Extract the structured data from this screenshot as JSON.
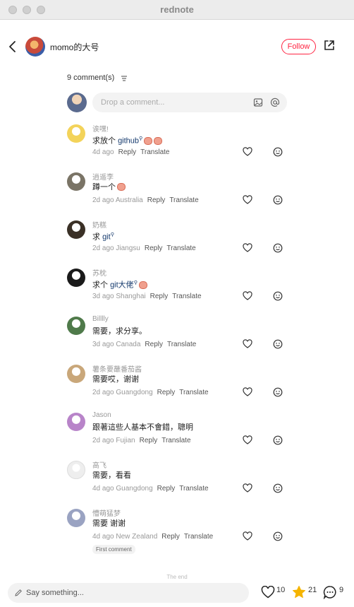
{
  "window": {
    "title": "rednote"
  },
  "header": {
    "author_name": "momo的大号",
    "follow_label": "Follow"
  },
  "comments_section": {
    "count_label": "9 comment(s)",
    "input_placeholder": "Drop a comment..."
  },
  "comments": [
    {
      "user": "诶嘿!",
      "text_before": "求放个 ",
      "link": "github",
      "text_after": "",
      "emoji_count": 2,
      "age": "4d ago",
      "location": "",
      "reply": "Reply",
      "translate": "Translate",
      "avatar_color": "#f3d35a"
    },
    {
      "user": "逍遥李",
      "text_before": "蹲一个",
      "link": "",
      "text_after": "",
      "emoji_count": 1,
      "age": "2d ago",
      "location": "Australia",
      "reply": "Reply",
      "translate": "Translate",
      "avatar_color": "#7a7466"
    },
    {
      "user": "奶糕",
      "text_before": "求 ",
      "link": "git",
      "text_after": "",
      "emoji_count": 0,
      "age": "2d ago",
      "location": "Jiangsu",
      "reply": "Reply",
      "translate": "Translate",
      "avatar_color": "#3a3026"
    },
    {
      "user": "苏枕",
      "text_before": "求个 ",
      "link": "git大佬",
      "text_after": "",
      "emoji_count": 1,
      "age": "3d ago",
      "location": "Shanghai",
      "reply": "Reply",
      "translate": "Translate",
      "avatar_color": "#1a1a1a"
    },
    {
      "user": "Billlly",
      "text_before": "需要，求分享。",
      "link": "",
      "text_after": "",
      "emoji_count": 0,
      "age": "3d ago",
      "location": "Canada",
      "reply": "Reply",
      "translate": "Translate",
      "avatar_color": "#4f7a4a"
    },
    {
      "user": "薯条要蘸番茄酱",
      "text_before": "需要哎，谢谢",
      "link": "",
      "text_after": "",
      "emoji_count": 0,
      "age": "2d ago",
      "location": "Guangdong",
      "reply": "Reply",
      "translate": "Translate",
      "avatar_color": "#c9a77a"
    },
    {
      "user": "Jason",
      "text_before": "跟著這些人基本不會錯，聰明",
      "link": "",
      "text_after": "",
      "emoji_count": 0,
      "age": "2d ago",
      "location": "Fujian",
      "reply": "Reply",
      "translate": "Translate",
      "avatar_color": "#b884c9"
    },
    {
      "user": "高飞",
      "text_before": "需要，看看",
      "link": "",
      "text_after": "",
      "emoji_count": 0,
      "age": "4d ago",
      "location": "Guangdong",
      "reply": "Reply",
      "translate": "Translate",
      "avatar_color": "#eeeeee"
    },
    {
      "user": "懵萌猛梦",
      "text_before": "需要 谢谢",
      "link": "",
      "text_after": "",
      "emoji_count": 0,
      "age": "4d ago",
      "location": "New Zealand",
      "reply": "Reply",
      "translate": "Translate",
      "avatar_color": "#9aa3c2",
      "badge": "First comment"
    }
  ],
  "end_label": "The end",
  "bottom_bar": {
    "say_placeholder": "Say something...",
    "likes": "10",
    "stars": "21",
    "comments": "9"
  },
  "colors": {
    "accent": "#ff2442",
    "star": "#f5b400",
    "link": "#13386c"
  },
  "icons": [
    "back-icon",
    "share-icon",
    "sort-icon",
    "image-icon",
    "at-icon",
    "heart-icon",
    "face-icon",
    "pencil-icon",
    "star-icon",
    "chat-icon"
  ]
}
